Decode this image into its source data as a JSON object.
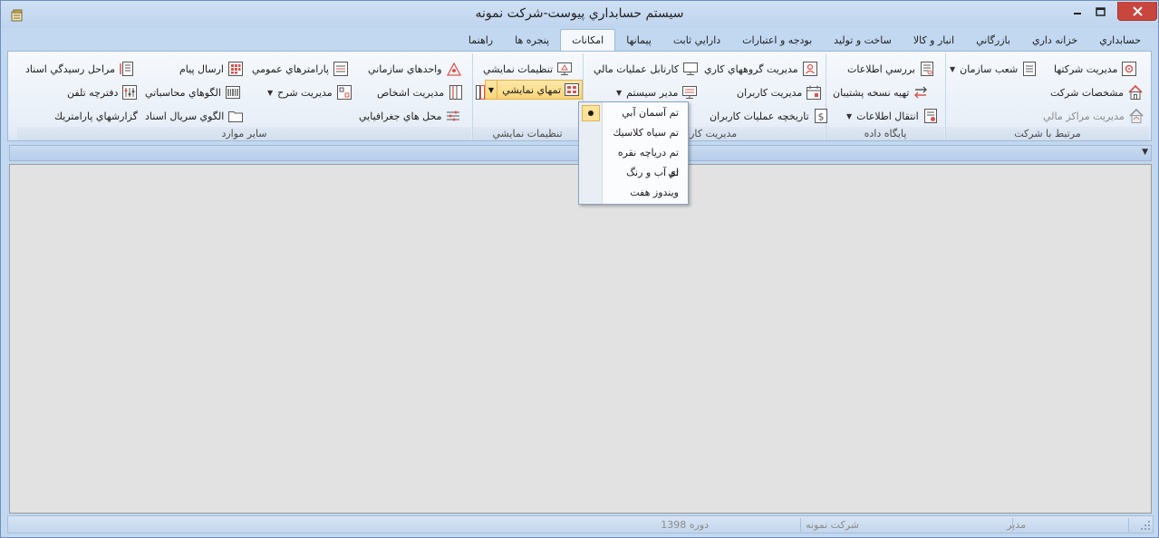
{
  "window": {
    "title": "سيستم حسابداري پيوست-شركت نمونه"
  },
  "tabs": [
    "حسابداري",
    "خزانه داري",
    "بازرگاني",
    "انبار و كالا",
    "ساخت و توليد",
    "بودجه و اعتبارات",
    "دارايي ثابت",
    "پيمانها",
    "امكانات",
    "پنجره ها",
    "راهنما"
  ],
  "active_tab_index": 8,
  "ribbon": {
    "group_company": {
      "label": "مرتبط با شركت",
      "manage_companies": "مديريت شركتها",
      "org_branches": "شعب سازمان",
      "company_specs": "مشخصات شركت",
      "financial_centers": "مديريت مراكز مالي"
    },
    "group_database": {
      "label": "پايگاه داده",
      "review_info": "بررسي اطلاعات",
      "backup": "تهيه نسخه پشتيبان",
      "transfer_info": "انتقال اطلاعات"
    },
    "group_users": {
      "label": "مديريت كاربران",
      "work_groups": "مديريت گروههاي كاري",
      "financial_cartable": "كارتابل عمليات مالي",
      "users": "مديريت كاربران",
      "system_admin": "مدير سيستم",
      "user_history": "تاريخچه عمليات كاربران"
    },
    "group_display": {
      "label": "تنظيمات نمايشي",
      "display_settings": "تنظيمات نمايشي",
      "display_themes": "تمهاي نمايشي"
    },
    "group_other": {
      "label": "ساير موارد",
      "org_units": "واحدهاي سازماني",
      "general_params": "پارامترهاي عمومي",
      "doc_approval": "مراحل رسيدگي اسناد",
      "persons": "مديريت اشخاص",
      "desc_manager": "مديريت شرح",
      "accounting_patterns": "الگوهاي محاسباتي",
      "phonebook": "دفترچه تلفن",
      "geo_locations": "محل هاي جغرافيايي",
      "doc_serial_pattern": "الگوي سريال اسناد",
      "send_message": "ارسال پيام",
      "param_reports": "گزارشهاي پارامتريك"
    }
  },
  "theme_menu": {
    "items": [
      "تم آسمان آبي",
      "تم سياه كلاسيك",
      "تم درياچه نقره اي",
      "تم آب و رنگ",
      "ويندوز هفت"
    ],
    "selected_index": 0
  },
  "status": {
    "user": "مدير",
    "company": "شركت نمونه",
    "period": "دوره 1398"
  },
  "colors": {
    "accent": "#fbd579",
    "close_button": "#c9463d",
    "workspace": "#e2e2e2"
  }
}
